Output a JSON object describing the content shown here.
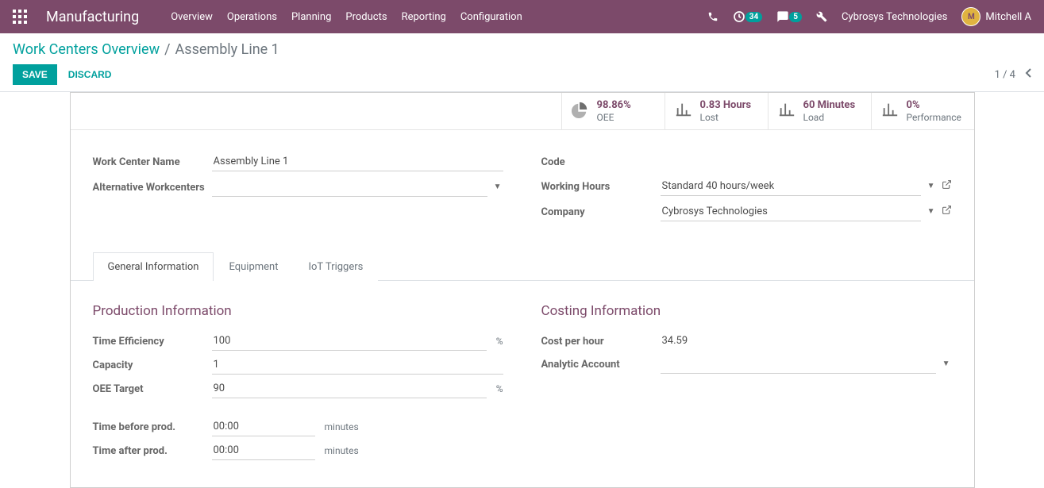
{
  "navbar": {
    "brand": "Manufacturing",
    "menu": [
      "Overview",
      "Operations",
      "Planning",
      "Products",
      "Reporting",
      "Configuration"
    ],
    "badge_clock": "34",
    "badge_chat": "5",
    "company": "Cybrosys Technologies",
    "user": "Mitchell A"
  },
  "breadcrumb": {
    "parent": "Work Centers Overview",
    "sep": "/",
    "current": "Assembly Line 1"
  },
  "cp": {
    "save": "Save",
    "discard": "Discard",
    "pager": "1 / 4"
  },
  "stats": {
    "oee": {
      "val": "98.86%",
      "lbl": "OEE"
    },
    "lost": {
      "val": "0.83 Hours",
      "lbl": "Lost"
    },
    "load": {
      "val": "60 Minutes",
      "lbl": "Load"
    },
    "perf": {
      "val": "0%",
      "lbl": "Performance"
    }
  },
  "fields": {
    "name_label": "Work Center Name",
    "name_value": "Assembly Line 1",
    "alt_label": "Alternative Workcenters",
    "alt_value": "",
    "code_label": "Code",
    "code_value": "",
    "hours_label": "Working Hours",
    "hours_value": "Standard 40 hours/week",
    "company_label": "Company",
    "company_value": "Cybrosys Technologies"
  },
  "tabs": {
    "general": "General Information",
    "equipment": "Equipment",
    "iot": "IoT Triggers"
  },
  "general": {
    "prod_title": "Production Information",
    "cost_title": "Costing Information",
    "time_eff_label": "Time Efficiency",
    "time_eff_value": "100",
    "capacity_label": "Capacity",
    "capacity_value": "1",
    "oee_target_label": "OEE Target",
    "oee_target_value": "90",
    "time_before_label": "Time before prod.",
    "time_before_value": "00:00",
    "time_after_label": "Time after prod.",
    "time_after_value": "00:00",
    "unit_percent": "%",
    "unit_minutes": "minutes",
    "cost_label": "Cost per hour",
    "cost_value": "34.59",
    "analytic_label": "Analytic Account",
    "analytic_value": ""
  }
}
